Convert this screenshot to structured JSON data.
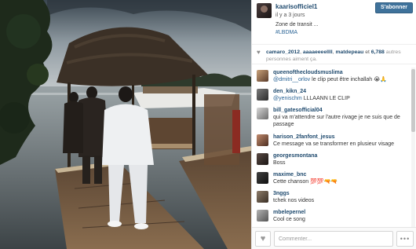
{
  "post": {
    "username": "kaarisofficiel1",
    "time": "il y a 3 jours",
    "caption_line1": "Zone de transit ...",
    "caption_hashtag": "#LBDMA",
    "follow_label": "S'abonner"
  },
  "likes": {
    "user1": "camaro_2012",
    "sep1": ", ",
    "user2": "aaaaeeeellll",
    "sep2": ", ",
    "user3": "matdepeau",
    "mid": " et ",
    "count": "6,788",
    "rest": " autres personnes aiment ça."
  },
  "comments": [
    {
      "user": "queenofthecloudsmuslima",
      "mention": "@dmitri__orlov",
      "text": " le clip peut être inchallah 😭🙏"
    },
    {
      "user": "den_kikn_24",
      "mention": "@yenischm",
      "text": " LLLAANN LE CLIP"
    },
    {
      "user": "bill_gatesofficial04",
      "mention": "",
      "text": "qui va m'attendre sur l'autre rivage je ne suis que de passage"
    },
    {
      "user": "harison_2fanfont_jesus",
      "mention": "",
      "text": "Ce message va se transformer en plusieur visage"
    },
    {
      "user": "georgesmontana",
      "mention": "",
      "text": "Boss"
    },
    {
      "user": "maxime_bnc",
      "mention": "",
      "text": "Cette chanson 💯💯🔫🔫"
    },
    {
      "user": "3nggs",
      "mention": "",
      "text": "tchek nos videos"
    },
    {
      "user": "mbelepernel",
      "mention": "",
      "text": "Cool ce song"
    }
  ],
  "footer": {
    "comment_placeholder": "Commenter...",
    "like_icon": "heart-icon",
    "more_label": "•••"
  },
  "colors": {
    "username": "#1f4a6e",
    "follow_button": "#3f729b",
    "mention": "#2a6496"
  }
}
